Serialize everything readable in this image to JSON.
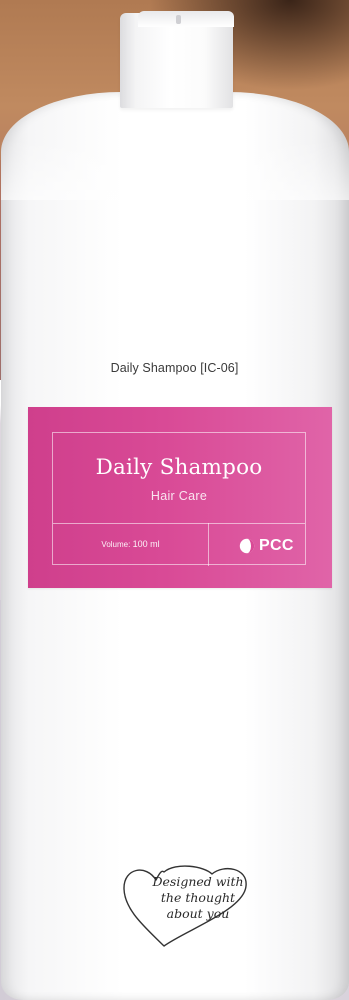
{
  "product": {
    "code_line": "Daily Shampoo [IC-06]",
    "label": {
      "title": "Daily Shampoo",
      "subtitle": "Hair Care",
      "volume_label": "Volume:",
      "volume_value": "100 ml",
      "brand": "PCC",
      "color": "#d94a96"
    },
    "badge": {
      "line1": "Designed with",
      "line2": "the thought",
      "line3": "about you"
    }
  },
  "icons": [
    "pcc-logo-icon",
    "heart-outline-icon"
  ]
}
